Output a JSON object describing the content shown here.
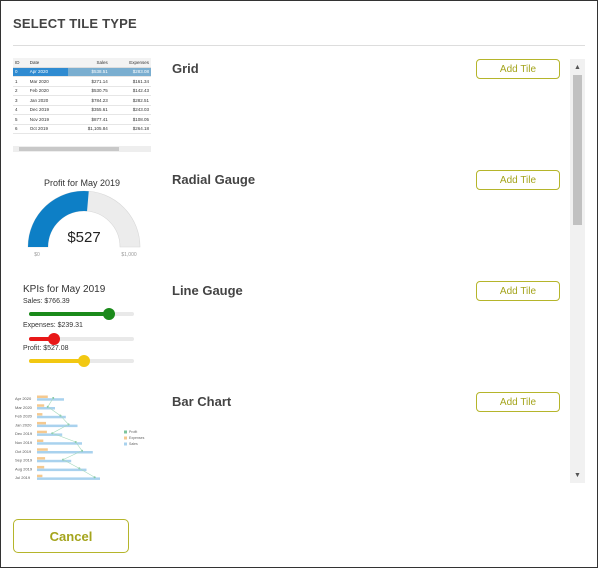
{
  "dialog": {
    "title": "SELECT TILE TYPE",
    "cancel_label": "Cancel"
  },
  "tiles": [
    {
      "name": "Grid",
      "button": "Add Tile"
    },
    {
      "name": "Radial Gauge",
      "button": "Add Tile"
    },
    {
      "name": "Line Gauge",
      "button": "Add Tile"
    },
    {
      "name": "Bar Chart",
      "button": "Add Tile"
    }
  ],
  "colors": {
    "accent_border": "#b5b52b",
    "accent_text": "#a4a41c",
    "grid_selected": "#2f8bd1",
    "gauge_blue": "#0d7fc6",
    "sales": "#1a8a1a",
    "expenses": "#e81818",
    "profit": "#f2c812"
  },
  "grid_preview": {
    "headers": [
      "ID",
      "Date",
      "Sales",
      "Expenses"
    ],
    "rows": [
      [
        "0",
        "Apr 2020",
        "$538.51",
        "$283.08"
      ],
      [
        "1",
        "Mar 2020",
        "$271.14",
        "$161.34"
      ],
      [
        "2",
        "Feb 2020",
        "$530.75",
        "$142.43"
      ],
      [
        "3",
        "Jan 2020",
        "$784.23",
        "$282.51"
      ],
      [
        "4",
        "Dec 2019",
        "$355.61",
        "$243.03"
      ],
      [
        "5",
        "Nov 2019",
        "$877.41",
        "$108.05"
      ],
      [
        "6",
        "Oct 2019",
        "$1,105.84",
        "$264.18"
      ]
    ]
  },
  "radial_preview": {
    "title": "Profit for May 2019",
    "value_label": "$527",
    "min_label": "$0",
    "max_label": "$1,000",
    "fraction": 0.527
  },
  "line_preview": {
    "title": "KPIs for May 2019",
    "sales_label": "Sales: $766.39",
    "expenses_label": "Expenses: $239.31",
    "profit_label": "Profit: $527.08",
    "sales_fraction": 0.766,
    "expenses_fraction": 0.239,
    "profit_fraction": 0.527
  },
  "bar_preview": {
    "categories": [
      "Apr 2020",
      "Mar 2020",
      "Feb 2020",
      "Jan 2020",
      "Dec 2019",
      "Nov 2019",
      "Oct 2019",
      "Sep 2019",
      "Aug 2019",
      "Jul 2019"
    ],
    "legend": [
      "Profit",
      "Expenses",
      "Sales"
    ]
  }
}
